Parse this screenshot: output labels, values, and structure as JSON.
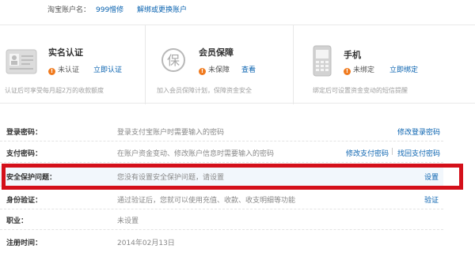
{
  "account": {
    "label": "淘宝账户名：",
    "name": "999憎修",
    "link": "解绑或更换账户"
  },
  "cards": [
    {
      "title": "实名认证",
      "status": "未认证",
      "action": "立即认证",
      "desc": "认证后可享受每月超2万的收款额度",
      "icon": "id-card-icon"
    },
    {
      "title": "会员保障",
      "status": "未保障",
      "action": "查看",
      "desc": "加入会员保障计划，保障资金安全",
      "icon": "shield-bao-icon",
      "icon_char": "保"
    },
    {
      "title": "手机",
      "status": "未绑定",
      "action": "立即绑定",
      "desc": "绑定后可设置资金变动的短信提醒",
      "icon": "mobile-phone-icon"
    }
  ],
  "warn_glyph": "!",
  "rows": [
    {
      "label": "登录密码：",
      "desc": "登录支付宝账户时需要输入的密码",
      "actions": [
        "修改登录密码"
      ]
    },
    {
      "label": "支付密码：",
      "desc": "在账户资金变动、修改账户信息时需要输入的密码",
      "actions": [
        "修改支付密码",
        "找回支付密码"
      ]
    },
    {
      "label": "安全保护问题：",
      "desc": "您没有设置安全保护问题，请设置",
      "actions": [
        "设置"
      ]
    },
    {
      "label": "身份验证：",
      "desc": "通过验证后，您就可以使用充值、收款、收支明细等功能",
      "actions": [
        "验证"
      ]
    },
    {
      "label": "职业：",
      "desc": "未设置",
      "actions": []
    },
    {
      "label": "注册时间：",
      "desc": "2014年02月13日",
      "actions": []
    }
  ],
  "action_separator": "|",
  "colors": {
    "link": "#0a63b0",
    "warning": "#f07a1e",
    "highlight_box": "#d4101a"
  }
}
